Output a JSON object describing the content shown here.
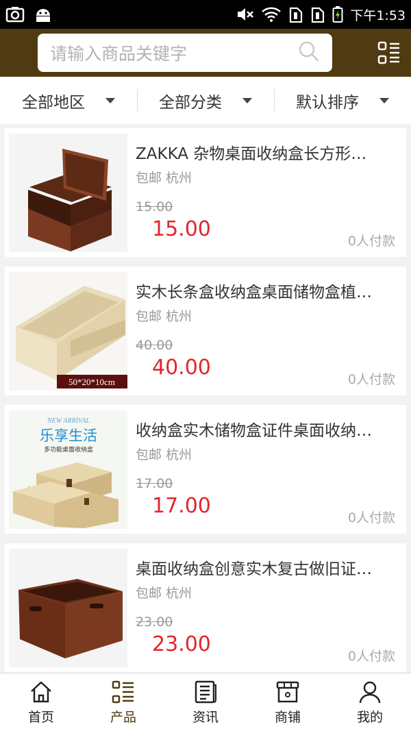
{
  "status_bar": {
    "time": "下午1:53"
  },
  "search": {
    "placeholder": "请输入商品关键字"
  },
  "filters": [
    {
      "label": "全部地区"
    },
    {
      "label": "全部分类"
    },
    {
      "label": "默认排序"
    }
  ],
  "products": [
    {
      "title": "ZAKKA 杂物桌面收纳盒长方形…",
      "tags": "包邮  杭州",
      "old_price": "15.00",
      "price": "15.00",
      "sales": "0人付款",
      "image_label": ""
    },
    {
      "title": "实木长条盒收纳盒桌面储物盒植…",
      "tags": "包邮  杭州",
      "old_price": "40.00",
      "price": "40.00",
      "sales": "0人付款",
      "image_label": "50*20*10cm"
    },
    {
      "title": "收纳盒实木储物盒证件桌面收纳…",
      "tags": "包邮  杭州",
      "old_price": "17.00",
      "price": "17.00",
      "sales": "0人付款",
      "image_label": "乐享生活",
      "image_sublabel": "多功能桌面收纳盒",
      "image_banner": "NEW ARRIVAL"
    },
    {
      "title": "桌面收纳盒创意实木复古做旧证…",
      "tags": "包邮  杭州",
      "old_price": "23.00",
      "price": "23.00",
      "sales": "0人付款",
      "image_label": ""
    }
  ],
  "tabs": [
    {
      "label": "首页",
      "icon": "home-icon"
    },
    {
      "label": "产品",
      "icon": "list-icon"
    },
    {
      "label": "资讯",
      "icon": "news-icon"
    },
    {
      "label": "商铺",
      "icon": "store-icon"
    },
    {
      "label": "我的",
      "icon": "user-icon"
    }
  ],
  "colors": {
    "header": "#4f3a11",
    "price": "#e2252b",
    "active_tab": "#4f3a11"
  }
}
